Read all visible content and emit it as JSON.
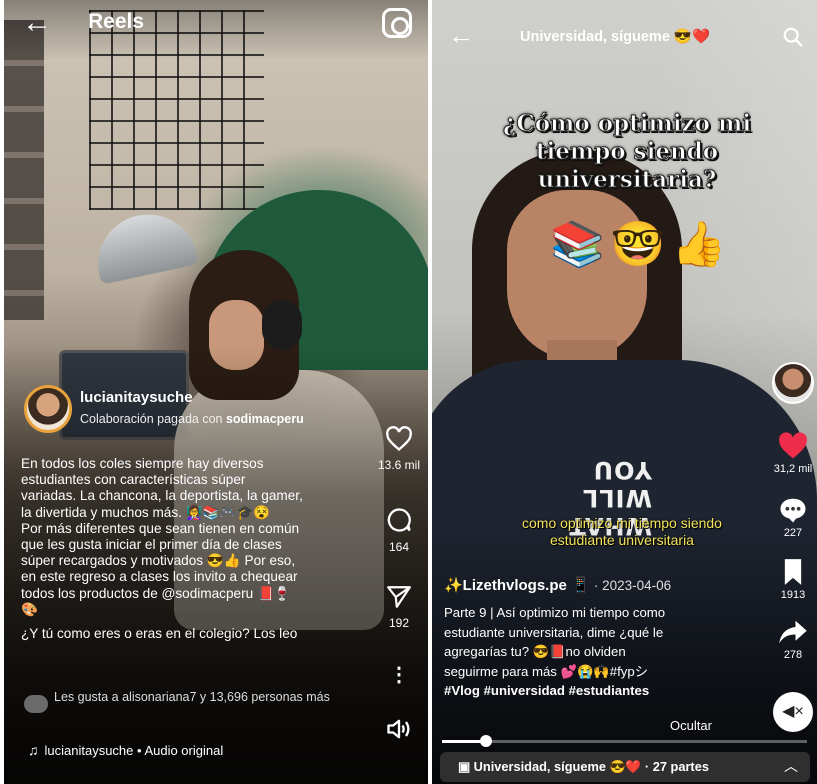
{
  "instagram": {
    "header": {
      "title": "Reels"
    },
    "post": {
      "username": "lucianitaysuche",
      "collab_prefix": "Colaboración pagada con",
      "collab_brand": "sodimacperu",
      "caption_lines": [
        "En todos los coles siempre hay diversos",
        "estudiantes con características súper",
        "variadas. La chancona, la deportista, la gamer,",
        "la divertida y muchos más. 👩‍🏫📚🎮🎓😵",
        "Por más diferentes que sean tienen en común",
        "que les gusta iniciar el primer día de clases",
        "súper recargados y motivados 😎👍 Por eso,",
        "en este regreso a clases los invito a chequear",
        "todos los productos de @sodimacperu 📕🍷",
        "🎨"
      ],
      "question": "¿Y tú como eres o eras en el colegio? Los leo",
      "likes_text": "Les gusta a alisonariana7 y 13,696 personas más",
      "audio": "lucianitaysuche • Audio original"
    },
    "actions": {
      "likes": "13.6 mil",
      "comments": "164",
      "shares": "192"
    }
  },
  "tiktok": {
    "header": {
      "title": "Universidad, sígueme 😎❤️"
    },
    "overlay": {
      "headline": "¿Cómo optimizo mi tiempo siendo universitaria?",
      "emojis": "📚🤓👍",
      "subtitle": "como optimizo mi tiempo siendo estudiante universitaria"
    },
    "actions": {
      "likes": "31,2 mil",
      "comments": "227",
      "saves": "1913",
      "shares": "278"
    },
    "post": {
      "author": "✨Lizethvlogs.pe 📱",
      "date": "· 2023-04-06",
      "desc_lines": [
        "Parte 9 | Así optimizo mi tiempo como",
        "estudiante universitaria, dime ¿qué le",
        "agregarías tu? 😎📕no olviden",
        "seguirme para más 💕😭🙌#fypシ"
      ],
      "hashtags": "#Vlog #universidad #estudiantes",
      "hide_label": "Ocultar"
    },
    "progress": 0.12,
    "series": "Universidad, sígueme 😎❤️ · 27 partes"
  }
}
